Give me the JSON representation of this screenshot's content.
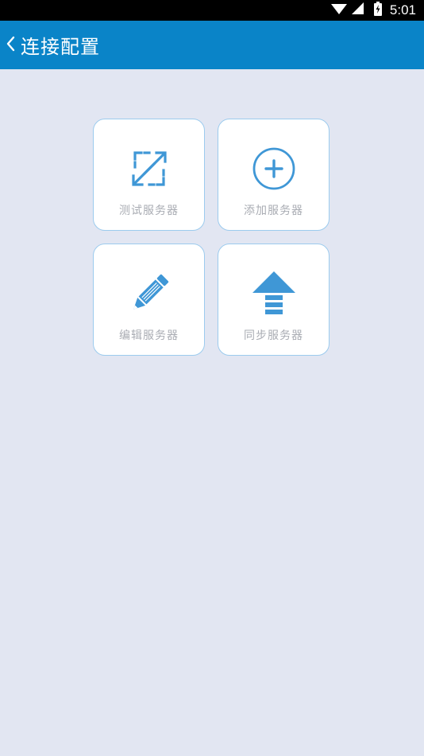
{
  "status_bar": {
    "time": "5:01",
    "icons": [
      "wifi-icon",
      "cell-signal-icon",
      "battery-icon"
    ]
  },
  "header": {
    "back_icon": "chevron-left-icon",
    "title": "连接配置"
  },
  "tiles": [
    {
      "label": "测试服务器",
      "icon": "expand-arrows-icon"
    },
    {
      "label": "添加服务器",
      "icon": "plus-circle-icon"
    },
    {
      "label": "编辑服务器",
      "icon": "pencil-icon"
    },
    {
      "label": "同步服务器",
      "icon": "upload-arrow-icon"
    }
  ],
  "colors": {
    "app_bar": "#0a84c8",
    "background": "#e2e6f2",
    "icon_blue": "#3f97d6",
    "tile_border": "#9ccbee",
    "label_gray": "#a9acb3"
  }
}
